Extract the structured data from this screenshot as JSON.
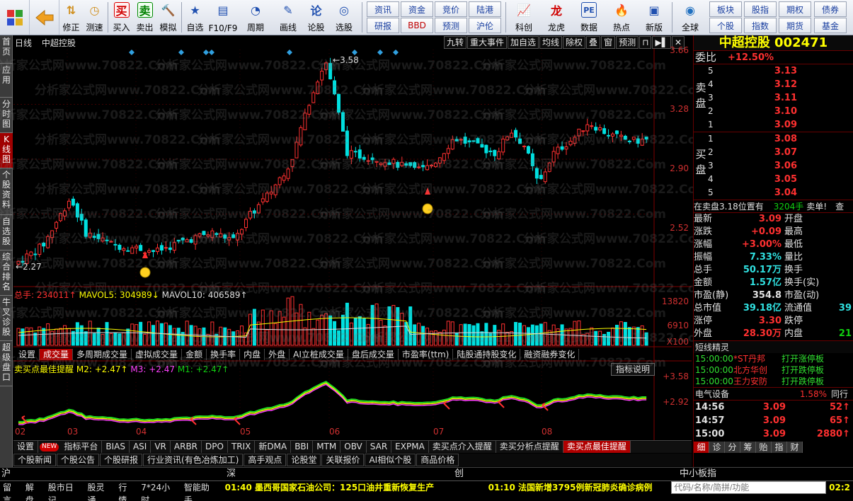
{
  "toolbar": {
    "big": [
      "",
      ""
    ],
    "buttons": [
      "修正",
      "测速",
      "买入",
      "卖出",
      "模拟",
      "自选",
      "F10/F9",
      "周期",
      "画线",
      "论股",
      "选股"
    ],
    "grid": [
      "资讯",
      "资金",
      "竞价",
      "陆港",
      "研报",
      "BBD",
      "预测",
      "沪伦"
    ],
    "buttons2": [
      "科创",
      "龙虎",
      "数据",
      "热点",
      "新版",
      "全球"
    ],
    "grid2": [
      "板块",
      "股指",
      "期权",
      "债券",
      "个股",
      "指数",
      "期货",
      "基金"
    ]
  },
  "leftbar": [
    "首页",
    "应用",
    "分时图",
    "K线图",
    "个股资料",
    "自选股",
    "综合排名",
    "牛叉诊股",
    "超级盘口"
  ],
  "chart": {
    "period": "日线",
    "name": "中超控股",
    "tools": [
      "九转",
      "重大事件",
      "加自选",
      "均线",
      "除权",
      "叠",
      "窗",
      "预测"
    ],
    "price_labels": [
      "3.66",
      "3.28",
      "2.90",
      "2.52"
    ],
    "high_label": "3.58",
    "low_label": "2.27",
    "vol_info": {
      "total": "总手: 234011↑",
      "ma5": "MAVOL5: 304989↓",
      "ma10": "MAVOL10: 406589↑"
    },
    "vol_labels": [
      "13820",
      "6910",
      "X100"
    ],
    "vol_tabs": [
      "设置",
      "成交量",
      "多周期成交量",
      "虚拟成交量",
      "金额",
      "换手率",
      "内盘",
      "外盘",
      "AI立桩成交量",
      "盘后成交量",
      "市盈率(ttm)",
      "陆股通持股变化",
      "融资融券变化"
    ],
    "ind_info": {
      "name": "卖买点最佳提醒",
      "m2": "M2: +2.47↑",
      "m3": "M3: +2.47",
      "m1": "M1: +2.47↑"
    },
    "ind_desc": "指标说明",
    "ind_labels": [
      "+3.58",
      "+2.92"
    ],
    "x_labels": [
      "02",
      "03",
      "04",
      "05",
      "06",
      "07",
      "08"
    ],
    "ind_tabs": [
      "设置",
      "指标平台",
      "BIAS",
      "ASI",
      "VR",
      "ARBR",
      "DPO",
      "TRIX",
      "新DMA",
      "BBI",
      "MTM",
      "OBV",
      "SAR",
      "EXPMA",
      "卖买点介入提醒",
      "卖买分析点提醒",
      "卖买点最佳提醒"
    ],
    "new_badge": "NEW",
    "news_tabs": [
      "个股新闻",
      "个股公告",
      "个股研报",
      "行业资讯(有色冶炼加工)",
      "高手观点",
      "论股堂",
      "关联报价",
      "AI相似个股",
      "商品价格"
    ],
    "watermark": "分析家公式网www.70822.Com"
  },
  "right": {
    "title": "中超控股 002471",
    "ratio_label": "委比",
    "ratio_value": "+12.50%",
    "sell_label": "卖盘",
    "buy_label": "买盘",
    "sells": [
      [
        "5",
        "3.13",
        ""
      ],
      [
        "4",
        "3.12",
        ""
      ],
      [
        "3",
        "3.11",
        ""
      ],
      [
        "2",
        "3.10",
        ""
      ],
      [
        "1",
        "3.09",
        ""
      ]
    ],
    "buys": [
      [
        "1",
        "3.08",
        ""
      ],
      [
        "2",
        "3.07",
        ""
      ],
      [
        "3",
        "3.06",
        ""
      ],
      [
        "4",
        "3.05",
        ""
      ],
      [
        "5",
        "3.04",
        ""
      ]
    ],
    "notice": "在卖盘3.18位置有",
    "notice_vol": "3204手",
    "notice_tail": "卖单!",
    "notice_more": "查",
    "quotes": [
      [
        "最新",
        "3.09",
        "开盘",
        ""
      ],
      [
        "涨跌",
        "+0.09",
        "最高",
        ""
      ],
      [
        "涨幅",
        "+3.00%",
        "最低",
        ""
      ],
      [
        "振幅",
        "7.33%",
        "量比",
        ""
      ],
      [
        "总手",
        "50.17万",
        "换手",
        ""
      ],
      [
        "金额",
        "1.57亿",
        "换手(实)",
        ""
      ],
      [
        "市盈(静)",
        "354.8",
        "市盈(动)",
        ""
      ],
      [
        "总市值",
        "39.18亿",
        "流通值",
        "39"
      ],
      [
        "涨停",
        "3.30",
        "跌停",
        ""
      ],
      [
        "外盘",
        "28.30万",
        "内盘",
        "21"
      ]
    ],
    "news_title": "短线精灵",
    "news": [
      [
        "15:00:00",
        "*ST丹邦",
        "打开涨停板"
      ],
      [
        "15:00:00",
        "北方华创",
        "打开跌停板"
      ],
      [
        "15:00:00",
        "王力安防",
        "打开跌停板"
      ]
    ],
    "sector": "电气设备",
    "sector_change": "1.58%",
    "sector_tail": "同行",
    "ticks": [
      [
        "14:56",
        "3.09",
        "52"
      ],
      [
        "14:57",
        "3.09",
        "65"
      ],
      [
        "15:00",
        "3.09",
        "2880"
      ]
    ],
    "side_tabs": [
      "细",
      "诊",
      "分",
      "筹",
      "贻",
      "指",
      "财"
    ]
  },
  "index_bar": {
    "sh": "沪",
    "sz": "深",
    "cy": "创",
    "zx": "中小板指"
  },
  "status": {
    "items": [
      "留言",
      "解盘",
      "股市日记",
      "股灵通",
      "行情",
      "7*24小时",
      "智能助手"
    ],
    "ticker1": "01:40 墨西哥国家石油公司：125口油井重新恢复生产",
    "ticker2": "01:10 法国新增3795例新冠肺炎确诊病例",
    "code_placeholder": "代码/名称/简拼/功能",
    "clock": "02:2"
  },
  "chart_data": {
    "type": "candlestick",
    "price_axis": [
      2.27,
      3.66
    ],
    "high": 3.58,
    "low": 2.27,
    "last": 3.09
  }
}
